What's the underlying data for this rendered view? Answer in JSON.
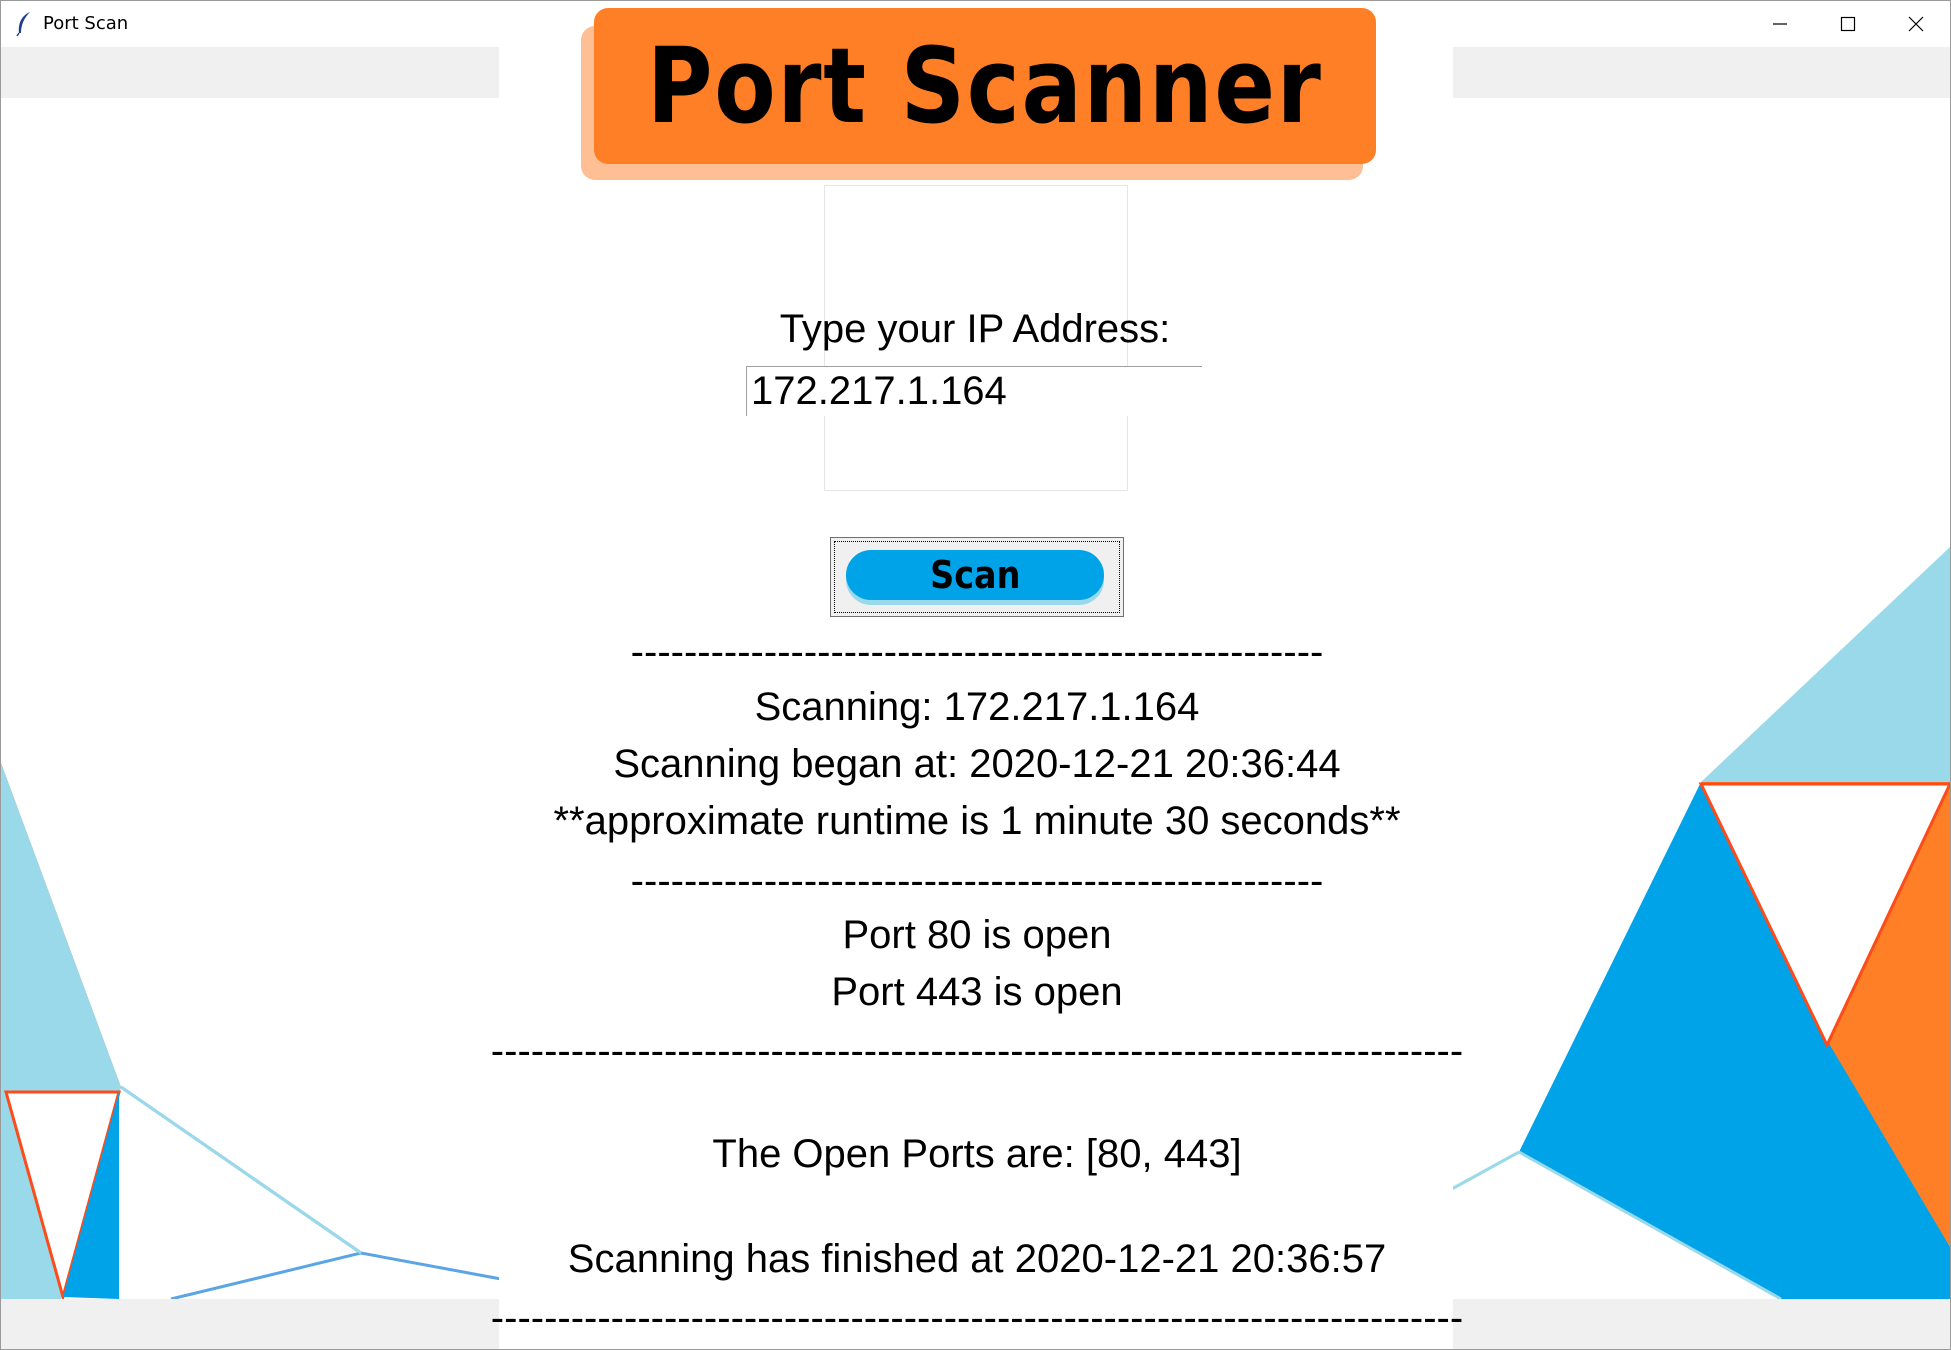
{
  "window": {
    "title": "Port Scan",
    "app_icon": "feather-icon",
    "controls": [
      "minimize-icon",
      "maximize-icon",
      "close-icon"
    ]
  },
  "banner": {
    "title": "Port Scanner"
  },
  "form": {
    "ip_label": "Type your IP Address:",
    "ip_value": "172.217.1.164",
    "scan_button": "Scan"
  },
  "output": {
    "sep_short_1": "----------------------------------------------------",
    "scanning_target": "Scanning: 172.217.1.164",
    "began_at": "Scanning began at: 2020-12-21 20:36:44",
    "runtime_note": "**approximate runtime is 1 minute 30 seconds**",
    "sep_short_2": "----------------------------------------------------",
    "port_lines": [
      "Port 80 is open",
      "Port 443 is open"
    ],
    "sep_long_1": "-------------------------------------------------------------------------",
    "open_ports": "The Open Ports are: [80, 443]",
    "finished_at": "Scanning has finished at 2020-12-21 20:36:57",
    "sep_long_2": "-------------------------------------------------------------------------"
  },
  "colors": {
    "accent_orange": "#ff7f27",
    "accent_orange_light": "#ffbf95",
    "accent_blue": "#00a2e8",
    "accent_blue_light": "#99d9ea",
    "band_gray": "#f0f0f0"
  }
}
